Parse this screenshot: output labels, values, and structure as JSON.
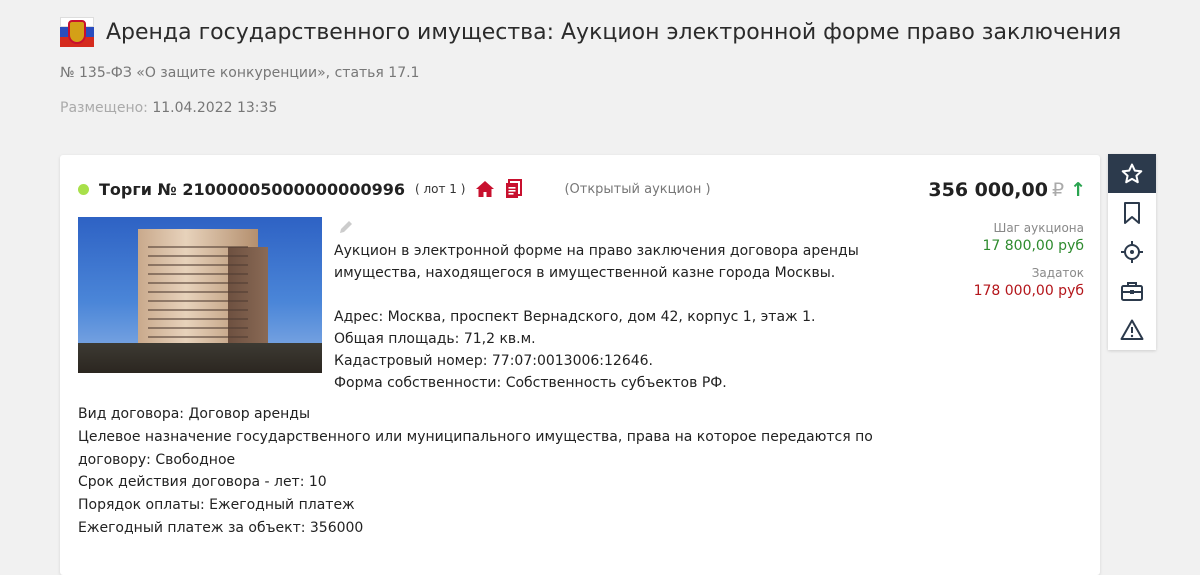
{
  "header": {
    "title": "Аренда государственного имущества: Аукцион электронной форме право заключения",
    "subtitle": "№ 135-ФЗ «О защите конкуренции», статья 17.1",
    "posted_label": "Размещено:",
    "posted_value": "11.04.2022 13:35"
  },
  "lot": {
    "torgi": "Торги № 21000005000000000996",
    "lot_label": "( лот 1 )",
    "auction_type": "(Открытый аукцион )",
    "status_color": "#a8e04a",
    "price": "356 000,00",
    "currency": "₽",
    "price_trend": "↑",
    "step_label": "Шаг аукциона",
    "step_value": "17 800,00 руб",
    "deposit_label": "Задаток",
    "deposit_value": "178 000,00 руб",
    "description": [
      "Аукцион в электронной форме на право заключения договора аренды",
      "имущества, находящегося в имущественной казне города Москвы."
    ],
    "address_lines": [
      "Адрес: Москва, проспект Вернадского, дом 42, корпус 1, этаж 1.",
      "Общая площадь:  71,2 кв.м.",
      "Кадастровый номер: 77:07:0013006:12646.",
      "Форма собственности: Собственность субъектов РФ."
    ],
    "details": [
      "Вид договора: Договор аренды",
      "Целевое назначение государственного или муниципального имущества, права на которое передаются по",
      "договору: Свободное",
      "Срок действия договора - лет: 10",
      "Порядок оплаты: Ежегодный платеж",
      "Ежегодный платеж за объект: 356000"
    ]
  },
  "toolbar": {
    "icons": [
      "star-icon",
      "bookmark-icon",
      "target-icon",
      "briefcase-icon",
      "warning-icon"
    ]
  }
}
